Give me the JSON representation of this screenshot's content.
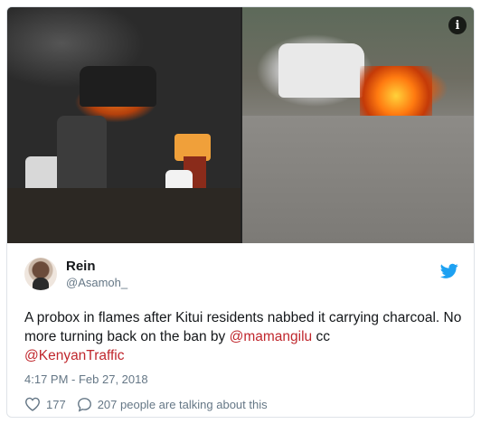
{
  "tweet": {
    "user": {
      "name": "Rein",
      "handle": "@Asamoh_"
    },
    "text_before": "A probox in flames after Kitui residents nabbed it carrying charcoal. No more turning back on the ban by ",
    "mention_1": "@mamangilu",
    "text_middle": " cc ",
    "mention_2": "@KenyanTraffic",
    "timestamp": "4:17 PM - Feb 27, 2018",
    "likes": "177",
    "talking": "207 people are talking about this"
  },
  "icons": {
    "info": "i",
    "brand": "twitter-bird-icon",
    "like": "heart-icon",
    "reply": "speech-bubble-icon"
  },
  "colors": {
    "mention": "#c0272d",
    "brand": "#1da1f2",
    "secondary_text": "#657786"
  }
}
